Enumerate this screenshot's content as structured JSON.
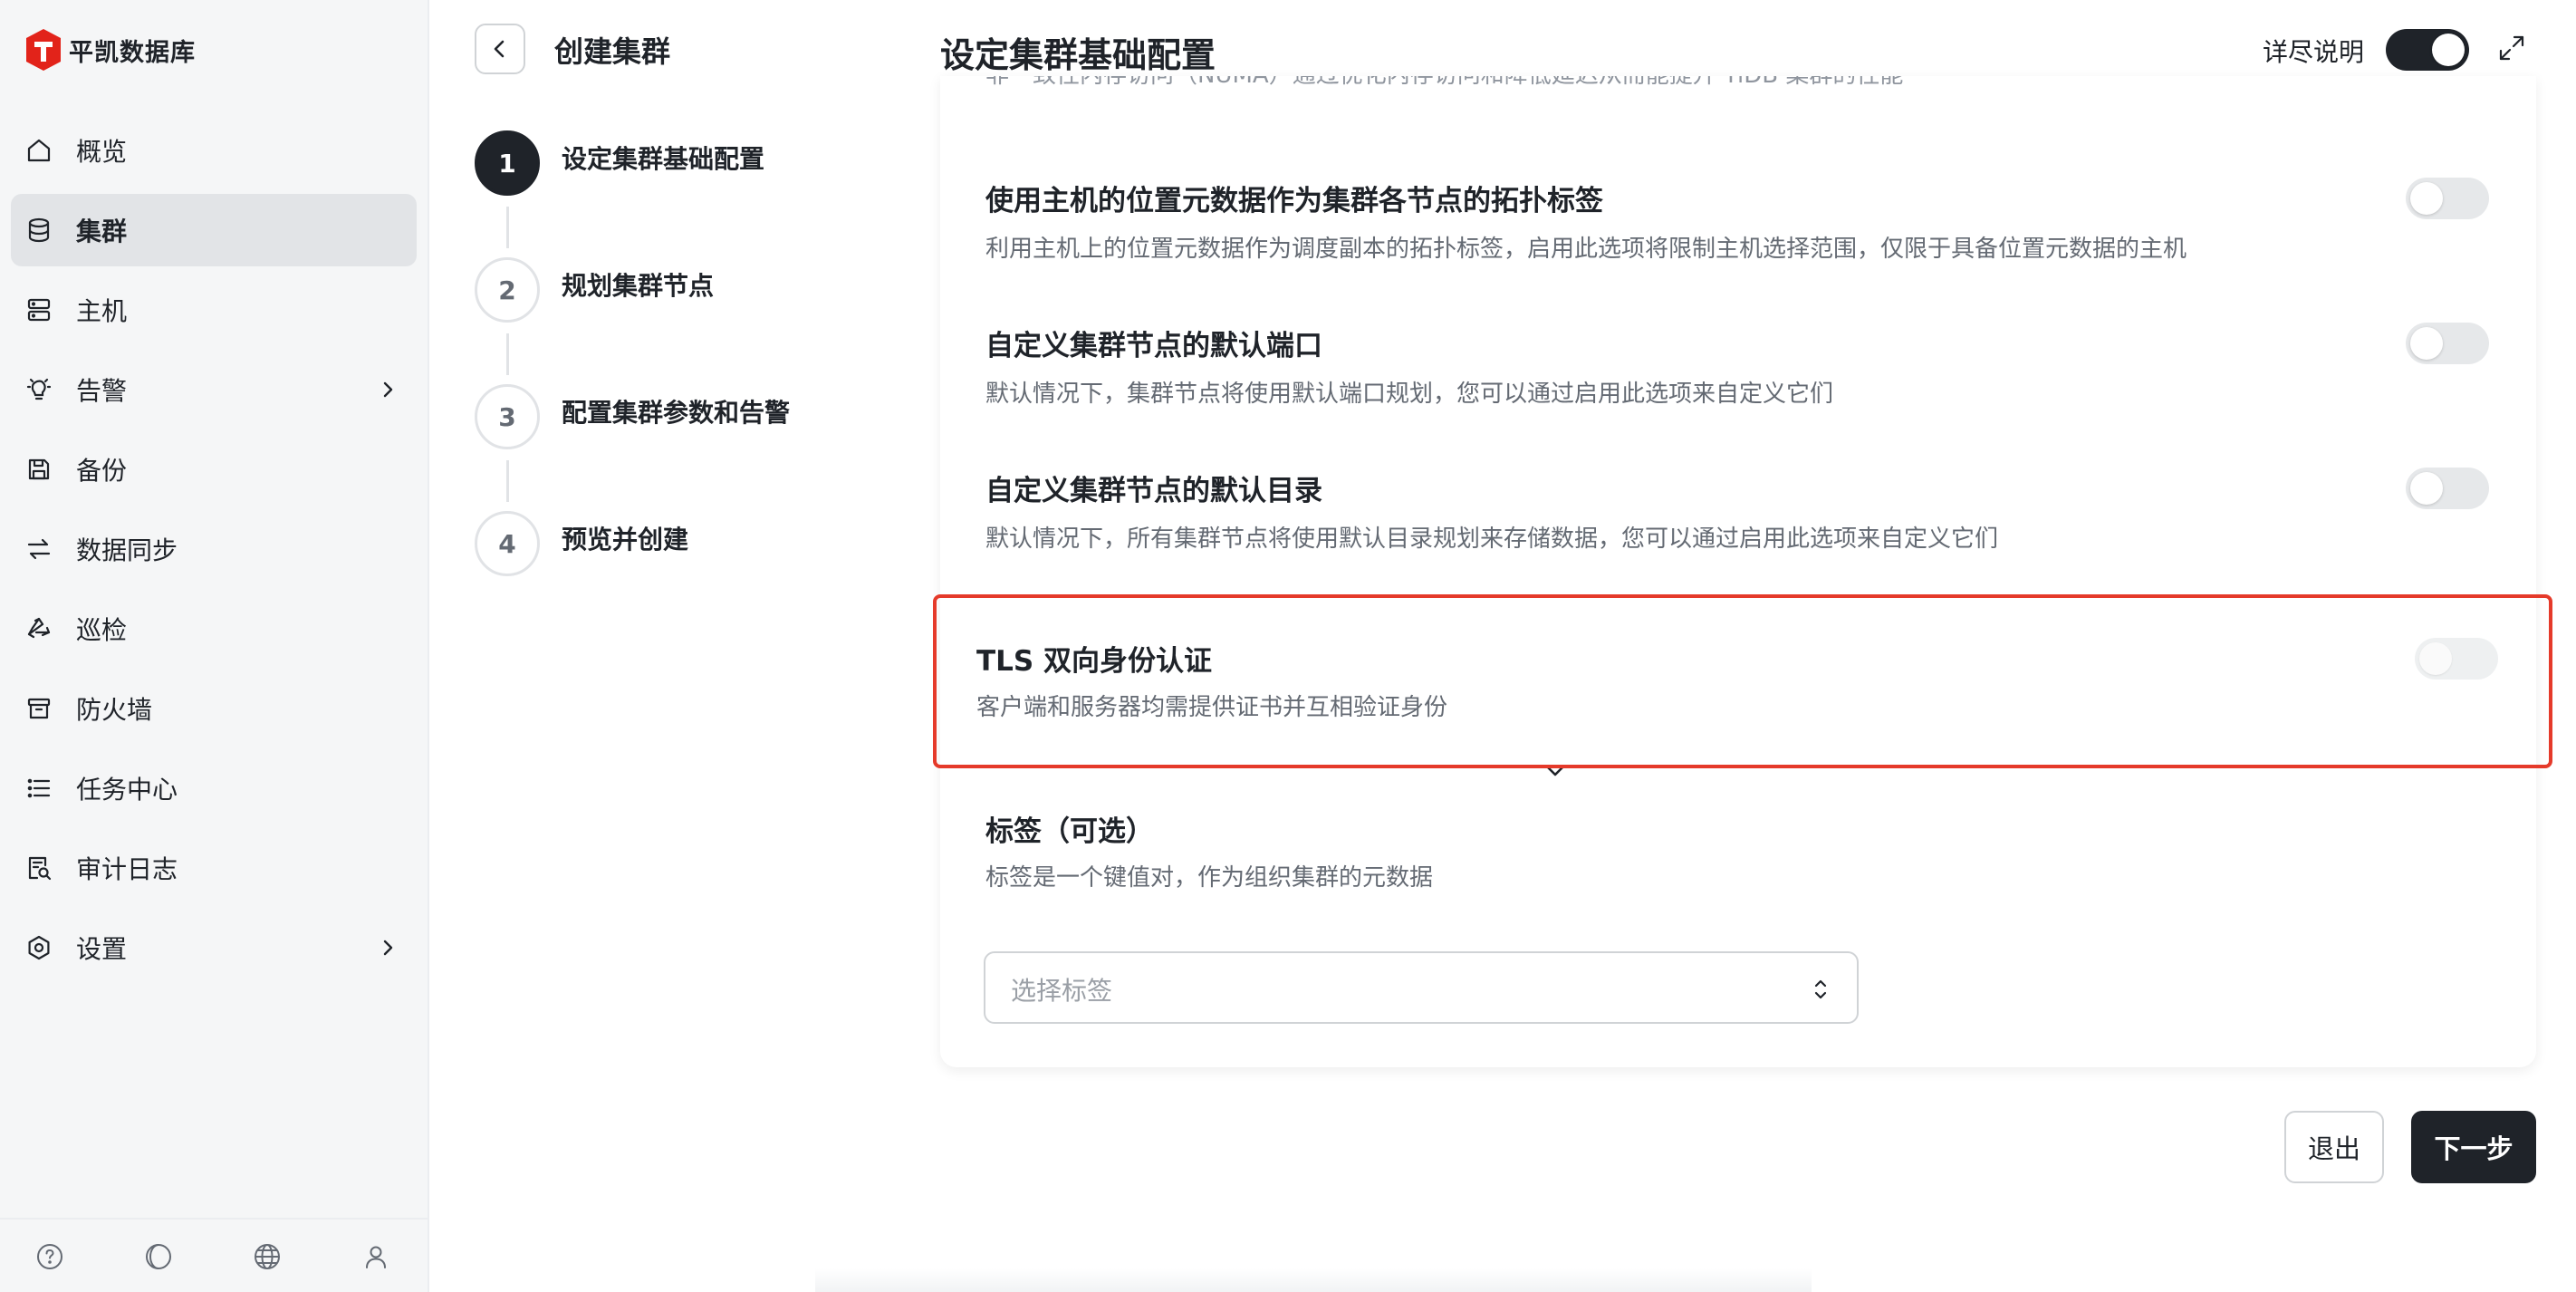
{
  "brand": {
    "name": "平凯数据库",
    "logo_color": "#e2231a"
  },
  "sidebar": {
    "items": [
      {
        "label": "概览",
        "icon": "home-icon",
        "active": false,
        "has_submenu": false
      },
      {
        "label": "集群",
        "icon": "database-icon",
        "active": true,
        "has_submenu": false
      },
      {
        "label": "主机",
        "icon": "server-icon",
        "active": false,
        "has_submenu": false
      },
      {
        "label": "告警",
        "icon": "bulb-icon",
        "active": false,
        "has_submenu": true
      },
      {
        "label": "备份",
        "icon": "save-icon",
        "active": false,
        "has_submenu": false
      },
      {
        "label": "数据同步",
        "icon": "sync-icon",
        "active": false,
        "has_submenu": false
      },
      {
        "label": "巡检",
        "icon": "recycle-icon",
        "active": false,
        "has_submenu": false
      },
      {
        "label": "防火墙",
        "icon": "archive-icon",
        "active": false,
        "has_submenu": false
      },
      {
        "label": "任务中心",
        "icon": "list-icon",
        "active": false,
        "has_submenu": false
      },
      {
        "label": "审计日志",
        "icon": "audit-log-icon",
        "active": false,
        "has_submenu": false
      },
      {
        "label": "设置",
        "icon": "gear-icon",
        "active": false,
        "has_submenu": true
      }
    ],
    "footer_icons": [
      "help-icon",
      "theme-icon",
      "globe-icon",
      "user-icon"
    ]
  },
  "wizard": {
    "title": "创建集群",
    "steps": [
      {
        "number": "1",
        "label": "设定集群基础配置",
        "active": true
      },
      {
        "number": "2",
        "label": "规划集群节点",
        "active": false
      },
      {
        "number": "3",
        "label": "配置集群参数和告警",
        "active": false
      },
      {
        "number": "4",
        "label": "预览并创建",
        "active": false
      }
    ]
  },
  "header": {
    "title": "设定集群基础配置",
    "detail_label": "详尽说明",
    "detail_enabled": true
  },
  "settings": {
    "cut_text": "非一致性内存访问（NUMA）通过优化内存访问和降低延迟从而能提升 TiDB 集群的性能",
    "options": [
      {
        "title": "使用主机的位置元数据作为集群各节点的拓扑标签",
        "desc": "利用主机上的位置元数据作为调度副本的拓扑标签，启用此选项将限制主机选择范围，仅限于具备位置元数据的主机",
        "enabled": false
      },
      {
        "title": "自定义集群节点的默认端口",
        "desc": "默认情况下，集群节点将使用默认端口规划，您可以通过启用此选项来自定义它们",
        "enabled": false
      },
      {
        "title": "自定义集群节点的默认目录",
        "desc": "默认情况下，所有集群节点将使用默认目录规划来存储数据，您可以通过启用此选项来自定义它们",
        "enabled": false
      },
      {
        "title": "TLS 双向身份认证",
        "desc": "客户端和服务器均需提供证书并互相验证身份",
        "enabled": false,
        "disabled": true
      }
    ],
    "tags": {
      "title": "标签（可选）",
      "desc": "标签是一个键值对，作为组织集群的元数据",
      "placeholder": "选择标签"
    }
  },
  "actions": {
    "exit_label": "退出",
    "next_label": "下一步"
  },
  "colors": {
    "primary": "#1f2329",
    "highlight": "#e53a2a",
    "active_nav": "#e2e4e7"
  }
}
